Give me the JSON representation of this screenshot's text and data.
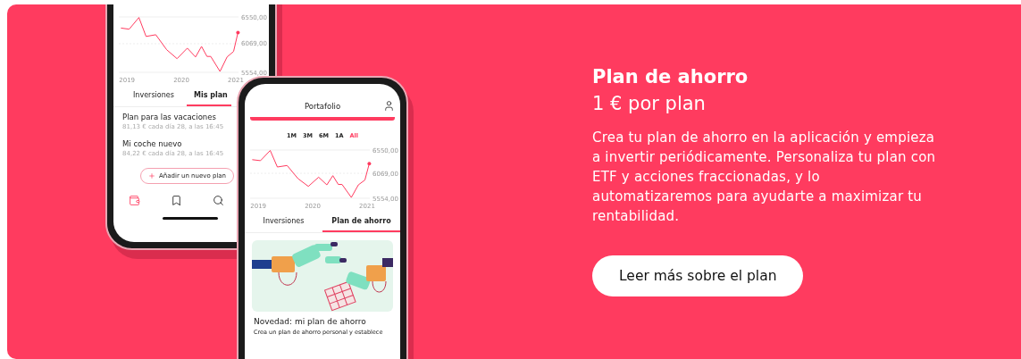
{
  "back_phone": {
    "chart_data": {
      "type": "line",
      "xlim": [
        2018.85,
        2021.05
      ],
      "ylim": [
        5554,
        6550
      ],
      "x": [
        2018.89,
        2019.04,
        2019.22,
        2019.35,
        2019.53,
        2019.73,
        2019.92,
        2020.11,
        2020.26,
        2020.37,
        2020.47,
        2020.54,
        2020.71,
        2020.84,
        2020.96,
        2021.04
      ],
      "series": [
        {
          "color": "#ff3b5f",
          "values": [
            6350,
            6330,
            6540,
            6200,
            6230,
            5960,
            5800,
            5990,
            5830,
            6020,
            5840,
            5840,
            5570,
            5830,
            5930,
            6270
          ]
        }
      ],
      "xticks": [
        {
          "value": 2019,
          "label": "2019"
        },
        {
          "value": 2020,
          "label": "2020"
        },
        {
          "value": 2021,
          "label": "2021"
        }
      ],
      "yticks": [
        {
          "value": 6550,
          "label": "6550,00"
        },
        {
          "value": 6069,
          "label": "6069,00"
        },
        {
          "value": 5554,
          "label": "5554,00"
        }
      ]
    },
    "tabs": [
      {
        "label": "Inversiones",
        "selected": false
      },
      {
        "label": "Mis plan",
        "selected": true
      }
    ],
    "plans": [
      {
        "name": "Plan para las vacaciones",
        "detail": "81,13 € cada día 28, a las 16:45"
      },
      {
        "name": "Mi coche nuevo",
        "detail": "84,22 € cada día 28, a las 16:45"
      }
    ],
    "add_button": "Añadir un nuevo plan",
    "nav": [
      {
        "kind": "wallet",
        "selected": true
      },
      {
        "kind": "bookmark",
        "selected": false
      },
      {
        "kind": "search",
        "selected": false
      }
    ]
  },
  "front_phone": {
    "header": "Portafolio",
    "periods": [
      {
        "label": "1M",
        "selected": false
      },
      {
        "label": "3M",
        "selected": false
      },
      {
        "label": "6M",
        "selected": false
      },
      {
        "label": "1A",
        "selected": false
      },
      {
        "label": "All",
        "selected": true
      }
    ],
    "chart_data": {
      "type": "line",
      "xlim": [
        2018.85,
        2021.05
      ],
      "ylim": [
        5554,
        6550
      ],
      "x": [
        2018.89,
        2019.04,
        2019.22,
        2019.35,
        2019.53,
        2019.73,
        2019.92,
        2020.11,
        2020.26,
        2020.37,
        2020.47,
        2020.54,
        2020.71,
        2020.84,
        2020.96,
        2021.04
      ],
      "series": [
        {
          "color": "#ff3b5f",
          "values": [
            6350,
            6330,
            6540,
            6200,
            6230,
            5960,
            5800,
            5990,
            5830,
            6020,
            5840,
            5840,
            5570,
            5830,
            5930,
            6270
          ]
        }
      ],
      "xticks": [
        {
          "value": 2019,
          "label": "2019"
        },
        {
          "value": 2020,
          "label": "2020"
        },
        {
          "value": 2021,
          "label": "2021"
        }
      ],
      "yticks": [
        {
          "value": 6550,
          "label": "6550,00"
        },
        {
          "value": 6069,
          "label": "6069,00"
        },
        {
          "value": 5554,
          "label": "5554,00"
        }
      ]
    },
    "tabs": [
      {
        "label": "Inversiones",
        "selected": false
      },
      {
        "label": "Plan de ahorro",
        "selected": true
      }
    ],
    "news": {
      "title": "Novedad: mi plan de ahorro",
      "text": "Crea un plan de ahorro personal y establece"
    }
  },
  "promo": {
    "title": "Plan de ahorro",
    "subtitle": "1 € por plan",
    "body": "Crea tu plan de ahorro en la aplicación y empieza a invertir periódicamente. Personaliza tu plan con ETF y acciones fraccionadas, y lo automatizaremos para ayudarte a maximizar tu rentabilidad.",
    "button": "Leer más sobre el plan"
  }
}
